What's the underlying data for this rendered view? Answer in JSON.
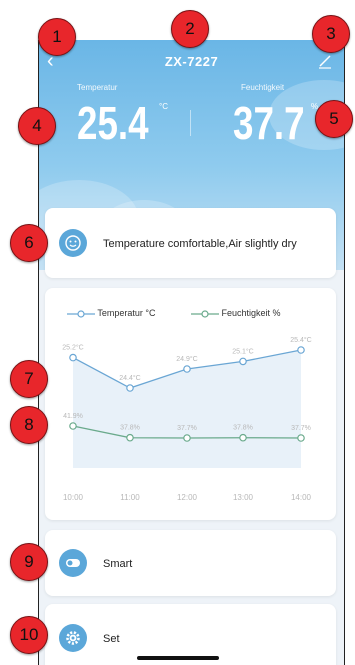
{
  "header": {
    "title": "ZX-7227",
    "temperature_label": "Temperatur",
    "temperature_value": "25.4",
    "temperature_unit": "°C",
    "humidity_label": "Feuchtigkeit",
    "humidity_value": "37.7",
    "humidity_unit": "%"
  },
  "status": {
    "message": "Temperature comfortable,Air slightly dry"
  },
  "chart_data": {
    "type": "line",
    "x": [
      "10:00",
      "11:00",
      "12:00",
      "13:00",
      "14:00"
    ],
    "series": [
      {
        "name": "Temperatur °C",
        "values": [
          25.2,
          24.4,
          24.9,
          25.1,
          25.4
        ],
        "labels": [
          "25.2°C",
          "24.4°C",
          "24.9°C",
          "25.1°C",
          "25.4°C"
        ],
        "color": "#6aa6d4"
      },
      {
        "name": "Feuchtigkeit %",
        "values": [
          41.9,
          37.8,
          37.7,
          37.8,
          37.7
        ],
        "labels": [
          "41.9%",
          "37.8%",
          "37.7%",
          "37.8%",
          "37.7%"
        ],
        "color": "#6aaa8c"
      }
    ]
  },
  "menu": {
    "smart_label": "Smart",
    "set_label": "Set"
  },
  "callouts": [
    "1",
    "2",
    "3",
    "4",
    "5",
    "6",
    "7",
    "8",
    "9",
    "10"
  ],
  "colors": {
    "accent": "#5ba7d9",
    "callout": "#e8262b"
  }
}
